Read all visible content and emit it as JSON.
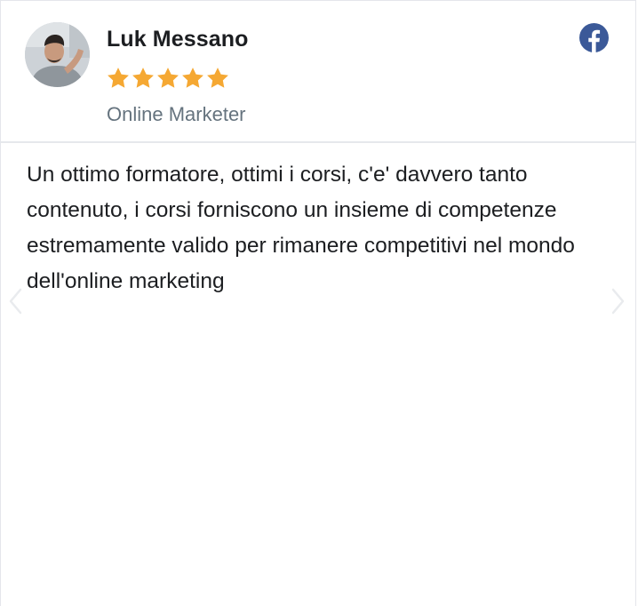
{
  "reviewer": {
    "name": "Luk Messano",
    "role": "Online Marketer",
    "rating": 5,
    "rating_max": 5
  },
  "review": {
    "text": "Un ottimo formatore, ottimi i corsi, c'e' davvero tanto contenuto, i corsi forniscono un insieme di competenze estremamente valido per rimanere competitivi nel mondo dell'online marketing"
  },
  "icons": {
    "source": "facebook-icon",
    "prev": "chevron-left-icon",
    "next": "chevron-right-icon",
    "rating": "star-icon"
  },
  "colors": {
    "star": "#f5a833",
    "facebook": "#3b5998",
    "name": "#1c1e21",
    "role": "#65737e",
    "divider": "#e6e8ec",
    "arrow": "#e9ebee"
  }
}
